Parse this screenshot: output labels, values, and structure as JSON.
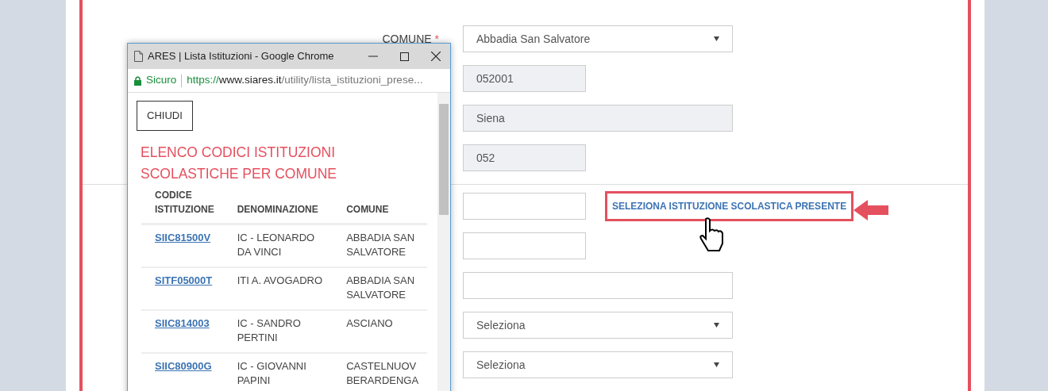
{
  "form": {
    "sections": [
      {
        "fields": [
          {
            "label": "COMUNE",
            "required_mark": "*",
            "kind": "select",
            "value": "Abbadia San Salvatore",
            "readonly": false
          },
          {
            "kind": "short-input",
            "value": "052001",
            "readonly": true
          },
          {
            "kind": "long-input",
            "value": "Siena",
            "readonly": true
          },
          {
            "kind": "short-input",
            "value": "052",
            "readonly": true
          }
        ]
      },
      {
        "fields": [
          {
            "kind": "short-input",
            "readonly": false,
            "action": "SELEZIONA ISTITUZIONE SCOLASTICA PRESENTE"
          },
          {
            "kind": "short-input",
            "readonly": false
          },
          {
            "kind": "long-input",
            "readonly": false
          },
          {
            "kind": "select",
            "value": "Seleziona",
            "readonly": false
          },
          {
            "kind": "select",
            "value": "Seleziona",
            "readonly": false
          }
        ]
      }
    ]
  },
  "popup": {
    "title": "ARES | Lista Istituzioni - Google Chrome",
    "security": "Sicuro",
    "url": {
      "scheme": "https://",
      "host": "www.siares.it",
      "path": "/utility/lista_istituzioni_prese..."
    },
    "close_button": "CHIUDI",
    "heading": "ELENCO CODICI ISTITUZIONI SCOLASTICHE PER COMUNE",
    "table": {
      "columns": [
        "CODICE ISTITUZIONE",
        "DENOMINAZIONE",
        "COMUNE"
      ],
      "rows": [
        [
          "SIIC81500V",
          "IC - LEONARDO DA VINCI",
          "ABBADIA SAN SALVATORE"
        ],
        [
          "SITF05000T",
          "ITI A. AVOGADRO",
          "ABBADIA SAN SALVATORE"
        ],
        [
          "SIIC814003",
          "IC - SANDRO PERTINI",
          "ASCIANO"
        ],
        [
          "SIIC80900G",
          "IC - GIOVANNI PAPINI",
          "CASTELNUOV BERARDENGA"
        ]
      ]
    }
  }
}
